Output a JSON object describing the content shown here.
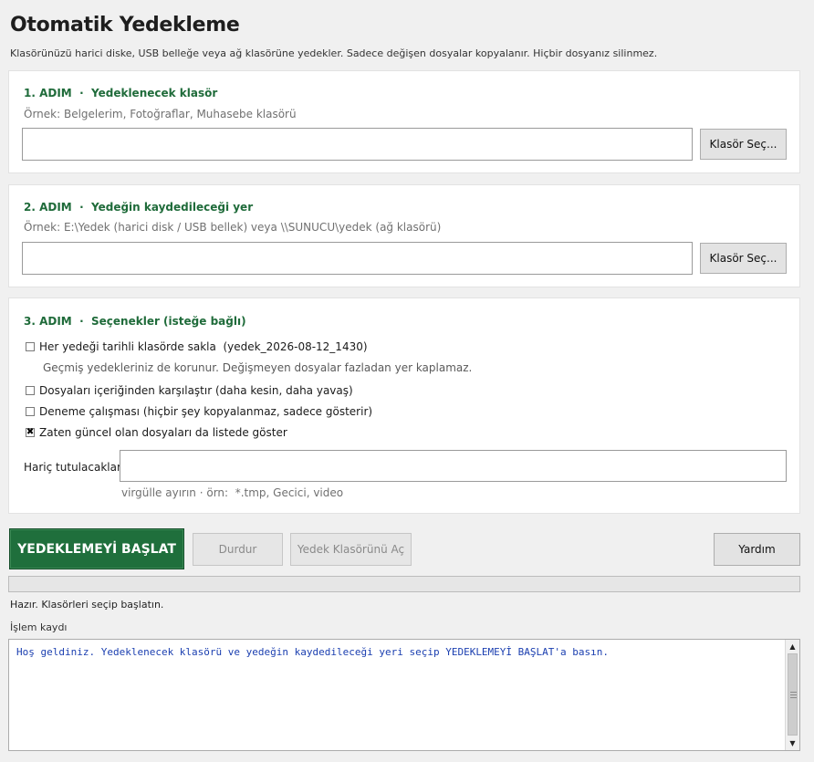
{
  "header": {
    "title": "Otomatik Yedekleme",
    "subtitle": "Klasörünüzü harici diske, USB belleğe veya ağ klasörüne yedekler. Sadece değişen dosyalar kopyalanır. Hiçbir dosyanız silinmez."
  },
  "step1": {
    "title": "1. ADIM  ·  Yedeklenecek klasör",
    "hint": "Örnek: Belgelerim, Fotoğraflar, Muhasebe klasörü",
    "value": "",
    "browse_label": "Klasör Seç..."
  },
  "step2": {
    "title": "2. ADIM  ·  Yedeğin kaydedileceği yer",
    "hint": "Örnek: E:\\Yedek (harici disk / USB bellek) veya \\\\SUNUCU\\yedek (ağ klasörü)",
    "value": "",
    "browse_label": "Klasör Seç..."
  },
  "step3": {
    "title": "3. ADIM  ·  Seçenekler (isteğe bağlı)",
    "options": [
      {
        "label": "Her yedeği tarihli klasörde sakla  (yedek_2026-08-12_1430)",
        "checked": false
      },
      {
        "label": "Dosyaları içeriğinden karşılaştır (daha kesin, daha yavaş)",
        "checked": false
      },
      {
        "label": "Deneme çalışması (hiçbir şey kopyalanmaz, sadece gösterir)",
        "checked": false
      },
      {
        "label": "Zaten güncel olan dosyaları da listede göster",
        "checked": true
      }
    ],
    "option1_note": "Geçmiş yedekleriniz de korunur. Değişmeyen dosyalar fazladan yer kaplamaz.",
    "exclude_label": "Hariç tutulacaklar:",
    "exclude_value": "",
    "exclude_hint": "virgülle ayırın · örn:  *.tmp, Gecici, video"
  },
  "actions": {
    "start": "YEDEKLEMEYİ BAŞLAT",
    "stop": "Durdur",
    "open_folder": "Yedek Klasörünü Aç",
    "help": "Yardım"
  },
  "progress": {
    "percent": 0
  },
  "status": "Hazır. Klasörleri seçip başlatın.",
  "log": {
    "label": "İşlem kaydı",
    "text": "Hoş geldiniz. Yedeklenecek klasörü ve yedeğin kaydedileceği yeri seçip YEDEKLEMEYİ BAŞLAT'a basın."
  },
  "colors": {
    "accent": "#1f6f3c",
    "step_title": "#1f6b3a",
    "log_text": "#1b3fb0"
  }
}
